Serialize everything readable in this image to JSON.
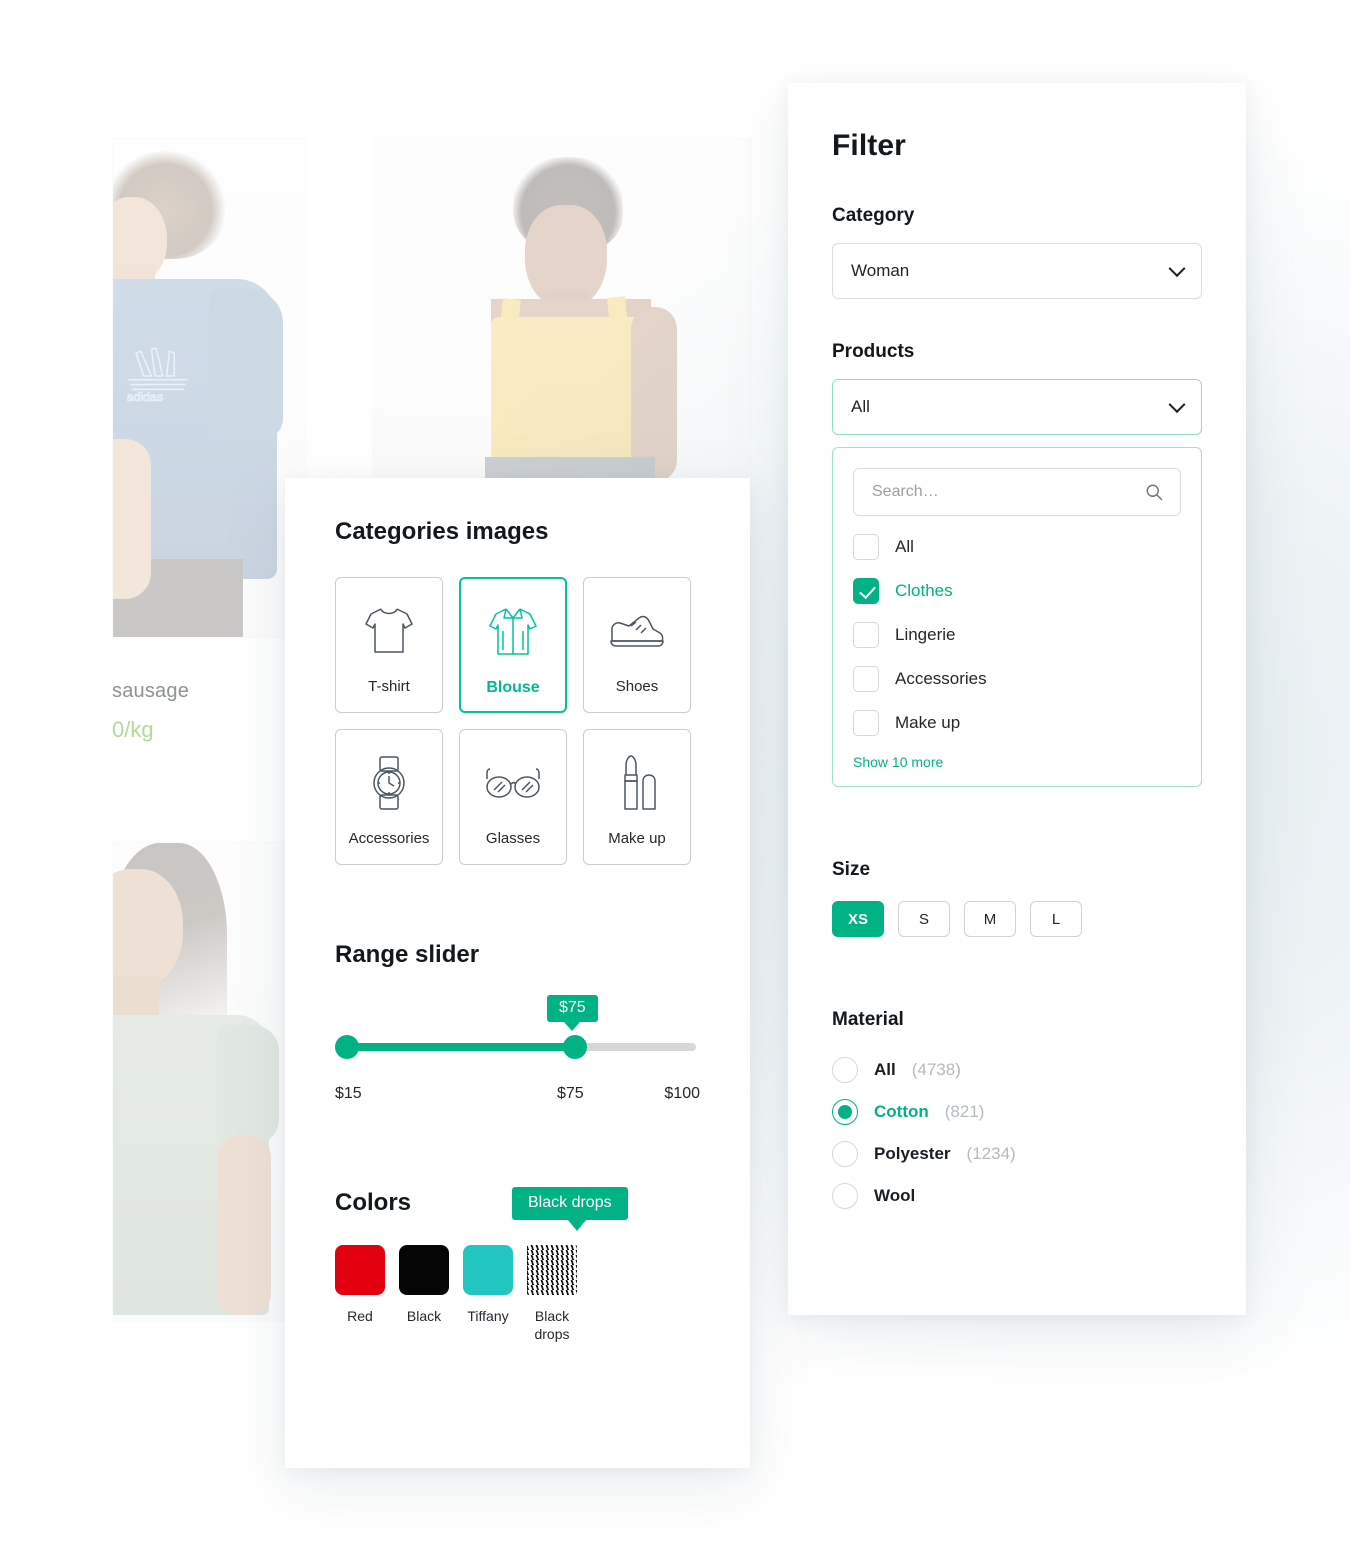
{
  "background_cards": [
    {
      "id": "card-adidas-tee",
      "title": "sausage",
      "price": "0/kg",
      "photo_alt": "man-in-blue-adidas-tshirt"
    },
    {
      "id": "card-yellow-top",
      "title": "",
      "price": "",
      "photo_alt": "woman-in-yellow-tank-top"
    },
    {
      "id": "card-green-tee",
      "title": "",
      "price": "",
      "photo_alt": "woman-in-sage-green-tshirt"
    }
  ],
  "filter": {
    "title": "Filter",
    "category": {
      "label": "Category",
      "value": "Woman",
      "icon": "chevron-down-icon"
    },
    "products": {
      "label": "Products",
      "value": "All",
      "icon": "chevron-down-icon",
      "search": {
        "placeholder": "Search…",
        "value": "",
        "icon": "search-icon"
      },
      "options": [
        {
          "label": "All",
          "checked": false
        },
        {
          "label": "Clothes",
          "checked": true
        },
        {
          "label": "Lingerie",
          "checked": false
        },
        {
          "label": "Accessories",
          "checked": false
        },
        {
          "label": "Make up",
          "checked": false
        }
      ],
      "show_more": "Show 10 more"
    },
    "size": {
      "label": "Size",
      "options": [
        {
          "label": "XS",
          "active": true
        },
        {
          "label": "S",
          "active": false
        },
        {
          "label": "M",
          "active": false
        },
        {
          "label": "L",
          "active": false
        }
      ]
    },
    "material": {
      "label": "Material",
      "options": [
        {
          "label": "All",
          "count": "(4738)",
          "selected": false
        },
        {
          "label": "Cotton",
          "count": "(821)",
          "selected": true
        },
        {
          "label": "Polyester",
          "count": "(1234)",
          "selected": false
        },
        {
          "label": "Wool",
          "count": "",
          "selected": false
        }
      ]
    }
  },
  "categories_panel": {
    "title": "Categories images",
    "items": [
      {
        "label": "T-shirt",
        "icon": "tshirt-icon",
        "active": false
      },
      {
        "label": "Blouse",
        "icon": "blouse-icon",
        "active": true
      },
      {
        "label": "Shoes",
        "icon": "shoe-icon",
        "active": false
      },
      {
        "label": "Accessories",
        "icon": "watch-icon",
        "active": false
      },
      {
        "label": "Glasses",
        "icon": "sunglasses-icon",
        "active": false
      },
      {
        "label": "Make up",
        "icon": "lipstick-icon",
        "active": false
      }
    ],
    "range_slider": {
      "title": "Range slider",
      "min_label": "$15",
      "current_label": "$75",
      "max_label": "$100",
      "bubble_label": "$75",
      "min": 15,
      "current": 75,
      "max": 100
    },
    "colors": {
      "title": "Colors",
      "tooltip": "Black drops",
      "swatches": [
        {
          "label": "Red",
          "hex": "#E3000F",
          "pattern": false
        },
        {
          "label": "Black",
          "hex": "#050505",
          "pattern": false
        },
        {
          "label": "Tiffany",
          "hex": "#22C5C0",
          "pattern": false
        },
        {
          "label": "Black drops",
          "hex": "#FFFFFF",
          "pattern": true
        }
      ]
    }
  },
  "theme": {
    "accent": "#00B284",
    "accent_light": "#00C39A",
    "text": "#12181C",
    "muted": "#B4BBBF",
    "border": "#DCDFE1"
  }
}
